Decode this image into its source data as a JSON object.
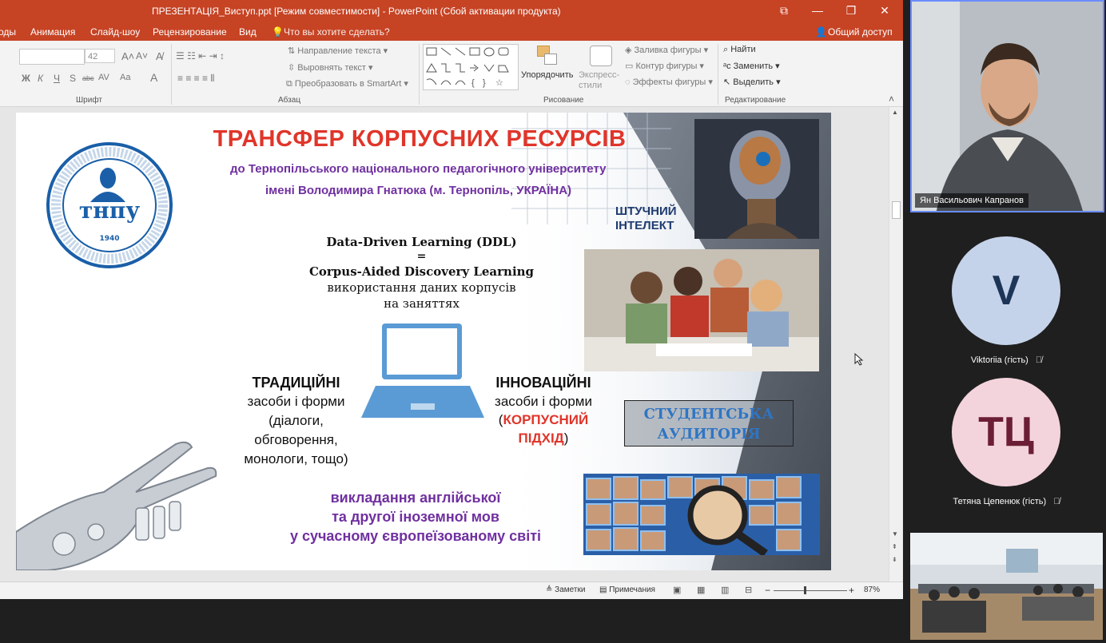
{
  "window": {
    "title": "ПРЕЗЕНТАЦІЯ_Виступ.ppt [Режим совместимости] - PowerPoint (Сбой активации продукта)",
    "controls": [
      "⧉",
      "—",
      "❐",
      "✕"
    ]
  },
  "tabs": [
    "оды",
    "Анимация",
    "Слайд-шоу",
    "Рецензирование",
    "Вид"
  ],
  "tell_me": "Что вы хотите сделать?",
  "share": "Общий доступ",
  "ribbon": {
    "font_size": "42",
    "groups": {
      "font": "Шрифт",
      "paragraph": "Абзац",
      "drawing": "Рисование",
      "editing": "Редактирование"
    },
    "paragraph_cmds": [
      "Направление текста",
      "Выровнять текст",
      "Преобразовать в SmartArt"
    ],
    "arrange": "Упорядочить",
    "quick_styles": "Экспресс-стили",
    "shape_cmds": [
      "Заливка фигуры",
      "Контур фигуры",
      "Эффекты фигуры"
    ],
    "editing_cmds": [
      "Найти",
      "Заменить",
      "Выделить"
    ],
    "font_btns": [
      "Ж",
      "К",
      "Ч",
      "S",
      "abc",
      "AV",
      "Aa"
    ]
  },
  "slide": {
    "title": "ТРАНСФЕР КОРПУСНИХ РЕСУРСІВ",
    "subtitle1": "до Тернопільського національного педагогічного університету",
    "subtitle2": "імені Володимира Гнатюка (м. Тернопіль, УКРАЇНА)",
    "ddl": "Data-Driven Learning (DDL)",
    "eq": "=",
    "cadl": "Corpus-Aided Discovery Learning",
    "use1": "використання даних корпусів",
    "use2": "на заняттях",
    "trad_head": "ТРАДИЦІЙНІ",
    "trad_lines": [
      "засоби і форми",
      "(діалоги,",
      "обговорення,",
      "монологи, тощо)"
    ],
    "innov_head": "ІННОВАЦІЙНІ",
    "innov_sub": "засоби і форми",
    "innov_open": "(",
    "innov_red1": "КОРПУСНИЙ",
    "innov_red2": "ПІДХІД",
    "innov_close": ")",
    "ai": [
      "ШТУЧНИЙ",
      "ІНТЕЛЕКТ"
    ],
    "students": [
      "СТУДЕНТСЬКА",
      "АУДИТОРІЯ"
    ],
    "bottom": [
      "викладання англійської",
      "та другої іноземної мов",
      "у сучасному європеїзованому світі"
    ],
    "logo": {
      "text": "тнпу",
      "year": "1940",
      "ring": "ТЕРНОПІЛЬСЬКИЙ НАЦІОНАЛЬНИЙ ПЕДАГОГІЧНИЙ УНІВЕРСИТЕТ ІМЕНІ ВОЛОДИМИРА ГНАТЮКА"
    }
  },
  "statusbar": {
    "notes": "Заметки",
    "comments": "Примечания",
    "zoom": "87%",
    "minus": "−",
    "plus": "+"
  },
  "participants": [
    {
      "name": "Ян Васильович Капранов"
    },
    {
      "name": "Viktoriia (гість)",
      "initials": "V",
      "color": "#c5d3ea",
      "text_color": "#1d3557"
    },
    {
      "name": "Тетяна Цепенюк (гість)",
      "initials": "ТЦ",
      "color": "#f4d4dc",
      "text_color": "#6b1e35"
    }
  ]
}
